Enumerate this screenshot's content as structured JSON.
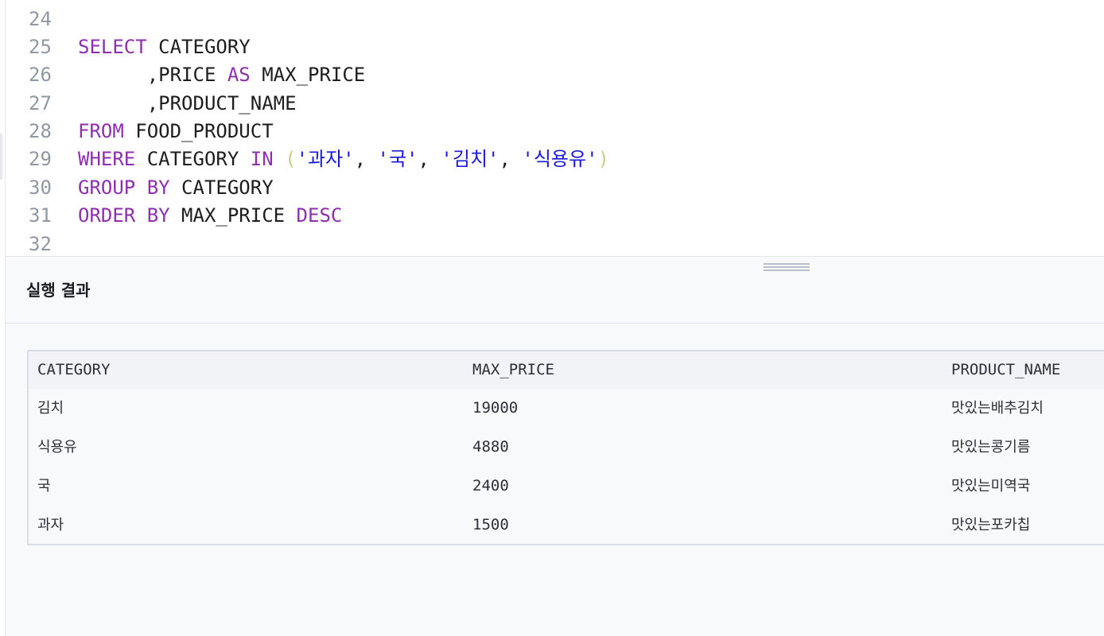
{
  "editor": {
    "lines": [
      {
        "num": "24",
        "tokens": []
      },
      {
        "num": "25",
        "tokens": [
          {
            "t": "SELECT",
            "c": "kw"
          },
          {
            "t": " CATEGORY",
            "c": "plain"
          }
        ]
      },
      {
        "num": "26",
        "tokens": [
          {
            "t": "      ,PRICE ",
            "c": "plain"
          },
          {
            "t": "AS",
            "c": "kw"
          },
          {
            "t": " MAX_PRICE",
            "c": "plain"
          }
        ]
      },
      {
        "num": "27",
        "tokens": [
          {
            "t": "      ,PRODUCT_NAME",
            "c": "plain"
          }
        ]
      },
      {
        "num": "28",
        "tokens": [
          {
            "t": "FROM",
            "c": "kw"
          },
          {
            "t": " FOOD_PRODUCT",
            "c": "plain"
          }
        ]
      },
      {
        "num": "29",
        "tokens": [
          {
            "t": "WHERE",
            "c": "kw"
          },
          {
            "t": " CATEGORY ",
            "c": "plain"
          },
          {
            "t": "IN",
            "c": "kw"
          },
          {
            "t": " ",
            "c": "plain"
          },
          {
            "t": "(",
            "c": "paren"
          },
          {
            "t": "'과자'",
            "c": "str"
          },
          {
            "t": ", ",
            "c": "plain"
          },
          {
            "t": "'국'",
            "c": "str"
          },
          {
            "t": ", ",
            "c": "plain"
          },
          {
            "t": "'김치'",
            "c": "str"
          },
          {
            "t": ", ",
            "c": "plain"
          },
          {
            "t": "'식용유'",
            "c": "str"
          },
          {
            "t": ")",
            "c": "paren"
          }
        ]
      },
      {
        "num": "30",
        "tokens": [
          {
            "t": "GROUP BY",
            "c": "kw"
          },
          {
            "t": " CATEGORY",
            "c": "plain"
          }
        ]
      },
      {
        "num": "31",
        "tokens": [
          {
            "t": "ORDER BY",
            "c": "kw"
          },
          {
            "t": " MAX_PRICE ",
            "c": "plain"
          },
          {
            "t": "DESC",
            "c": "kw"
          }
        ]
      },
      {
        "num": "32",
        "tokens": []
      }
    ]
  },
  "result": {
    "title": "실행 결과",
    "columns": [
      "CATEGORY",
      "MAX_PRICE",
      "PRODUCT_NAME"
    ],
    "rows": [
      [
        "김치",
        "19000",
        "맛있는배추김치"
      ],
      [
        "식용유",
        "4880",
        "맛있는콩기름"
      ],
      [
        "국",
        "2400",
        "맛있는미역국"
      ],
      [
        "과자",
        "1500",
        "맛있는포카칩"
      ]
    ]
  },
  "colors": {
    "keyword": "#8e2fae",
    "string": "#1a1ad6",
    "paren": "#d0c98a",
    "line_number": "#8f98a3"
  }
}
